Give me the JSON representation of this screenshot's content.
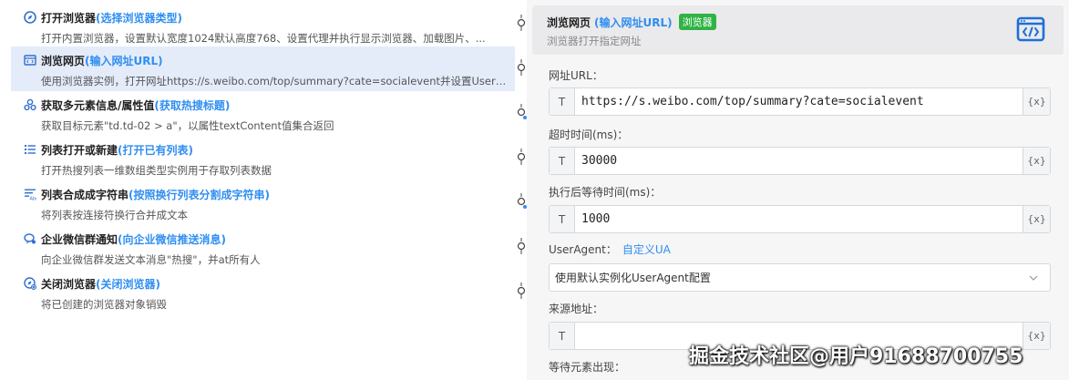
{
  "steps": [
    {
      "icon": "compass-icon",
      "name": "打开浏览器",
      "param": "(选择浏览器类型)",
      "desc": "打开内置浏览器，设置默认宽度1024默认高度768、设置代理并执行显示浏览器、加载图片、..."
    },
    {
      "icon": "browser-window-icon",
      "name": "浏览网页",
      "param": "(输入网址URL)",
      "desc": "使用浏览器实例，打开网址https://s.weibo.com/top/summary?cate=socialevent并设置UserAgent"
    },
    {
      "icon": "network-nodes-icon",
      "name": "获取多元素信息/属性值",
      "param": "(获取热搜标题)",
      "desc": "获取目标元素\"td.td-02 > a\"，以属性textContent值集合返回"
    },
    {
      "icon": "list-icon",
      "name": "列表打开或新建",
      "param": "(打开已有列表)",
      "desc": "打开热搜列表一维数组类型实例用于存取列表数据"
    },
    {
      "icon": "list-merge-icon",
      "name": "列表合成成字符串",
      "param": "(按照换行列表分割成字符串)",
      "desc": "将列表按连接符换行合并成文本"
    },
    {
      "icon": "chat-bubble-icon",
      "name": "企业微信群通知",
      "param": "(向企业微信推送消息)",
      "desc": "向企业微信群发送文本消息\"热搜\"，并at所有人"
    },
    {
      "icon": "close-browser-icon",
      "name": "关闭浏览器",
      "param": "(关闭浏览器)",
      "desc": "将已创建的浏览器对象销毁"
    }
  ],
  "panel": {
    "title": "浏览网页",
    "param": "(输入网址URL)",
    "badge": "浏览器",
    "subtitle": "浏览器打开指定网址",
    "icon": "browser-code-icon",
    "url_label": "网址URL：",
    "url_value": "https://s.weibo.com/top/summary?cate=socialevent",
    "timeout_label": "超时时间(ms)：",
    "timeout_value": "30000",
    "wait_label": "执行后等待时间(ms)：",
    "wait_value": "1000",
    "ua_label": "UserAgent：",
    "ua_link": "自定义UA",
    "ua_select": "使用默认实例化UserAgent配置",
    "source_label": "来源地址：",
    "source_value": "",
    "wait_element_label": "等待元素出现：",
    "type_tag": "T",
    "var_tag": "{x}"
  },
  "watermark": "掘金技术社区@用户91688700755",
  "colors": {
    "accent": "#2f8ef0",
    "badge": "#2fb344",
    "selected": "#e4ecfa"
  }
}
